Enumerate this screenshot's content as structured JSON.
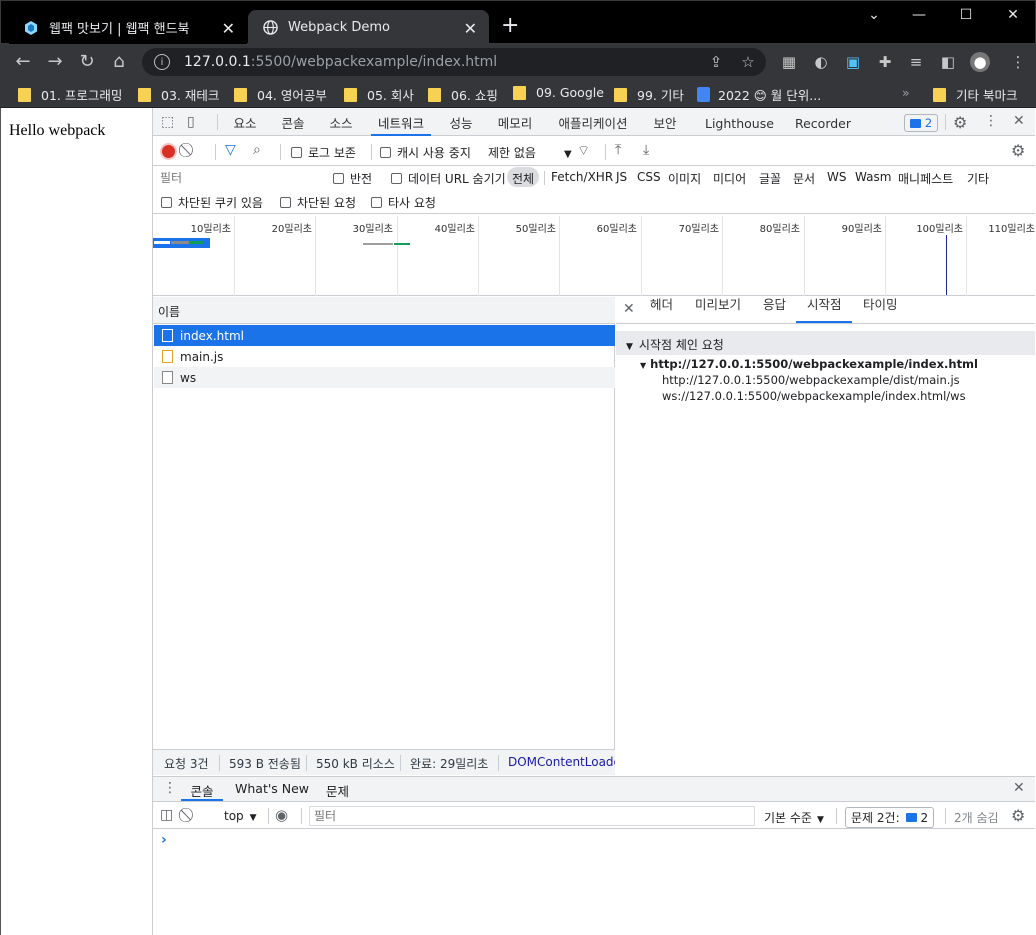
{
  "browser": {
    "tabs": [
      {
        "title": "웹팩 맛보기 | 웹팩 핸드북",
        "active": false
      },
      {
        "title": "Webpack Demo",
        "active": true
      }
    ],
    "url_host": "127.0.0.1",
    "url_path": ":5500/webpackexample/index.html",
    "bookmarks": [
      {
        "label": "01. 프로그래밍"
      },
      {
        "label": "03. 재테크"
      },
      {
        "label": "04. 영어공부"
      },
      {
        "label": "05. 회사"
      },
      {
        "label": "06. 쇼핑"
      },
      {
        "label": "09. Google"
      },
      {
        "label": "99. 기타"
      },
      {
        "label": "2022 😊 월 단위..."
      },
      {
        "label": "기타 북마크"
      }
    ],
    "overflow": "»"
  },
  "page": {
    "text": "Hello webpack"
  },
  "devtools": {
    "panels": [
      "요소",
      "콘솔",
      "소스",
      "네트워크",
      "성능",
      "메모리",
      "애플리케이션",
      "보안",
      "Lighthouse",
      "Recorder ⚗"
    ],
    "active_panel": "네트워크",
    "issues_badge": "2",
    "network": {
      "preserve_log": "로그 보존",
      "disable_cache": "캐시 사용 중지",
      "throttle": "제한 없음",
      "filter_placeholder": "필터",
      "invert": "반전",
      "hide_data_urls": "데이터 URL 숨기기",
      "type_filters": [
        "전체",
        "Fetch/XHR",
        "JS",
        "CSS",
        "이미지",
        "미디어",
        "글꼴",
        "문서",
        "WS",
        "Wasm",
        "매니페스트",
        "기타"
      ],
      "active_type": "전체",
      "blocked_cookies": "차단된 쿠키 있음",
      "blocked_requests": "차단된 요청",
      "third_party": "타사 요청",
      "timeline_ticks": [
        "10밀리초",
        "20밀리초",
        "30밀리초",
        "40밀리초",
        "50밀리초",
        "60밀리초",
        "70밀리초",
        "80밀리초",
        "90밀리초",
        "100밀리초",
        "110밀리초"
      ],
      "name_header": "이름",
      "requests": [
        {
          "name": "index.html",
          "selected": true
        },
        {
          "name": "main.js",
          "selected": false
        },
        {
          "name": "ws",
          "selected": false
        }
      ],
      "status": {
        "requests": "요청 3건",
        "transferred": "593 B 전송됨",
        "resources": "550 kB 리소스",
        "finish": "완료: 29밀리초",
        "dcl": "DOMContentLoaded"
      },
      "detail_tabs": [
        "헤더",
        "미리보기",
        "응답",
        "시작점",
        "타이밍"
      ],
      "active_detail_tab": "시작점",
      "initiator": {
        "section_title": "시작점 체인 요청",
        "root": "http://127.0.0.1:5500/webpackexample/index.html",
        "children": [
          "http://127.0.0.1:5500/webpackexample/dist/main.js",
          "ws://127.0.0.1:5500/webpackexample/index.html/ws"
        ]
      }
    },
    "drawer": {
      "tabs": [
        "콘솔",
        "What's New",
        "문제"
      ],
      "active_tab": "콘솔",
      "context": "top",
      "filter_placeholder": "필터",
      "level": "기본 수준",
      "issues": "문제 2건:",
      "issues_count": "2",
      "hidden": "2개 숨김",
      "prompt": "›"
    }
  }
}
